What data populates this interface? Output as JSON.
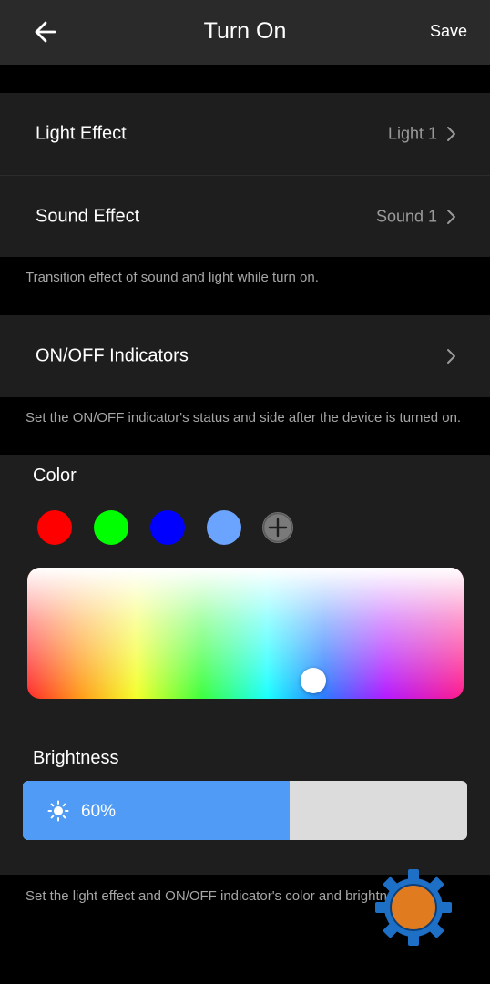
{
  "header": {
    "title": "Turn On",
    "save_label": "Save"
  },
  "effects": {
    "light": {
      "label": "Light Effect",
      "value": "Light 1"
    },
    "sound": {
      "label": "Sound Effect",
      "value": "Sound 1"
    },
    "hint": "Transition effect of sound and light while turn on."
  },
  "indicators": {
    "label": "ON/OFF Indicators",
    "hint": "Set the ON/OFF indicator's status and side after the device is turned on."
  },
  "color": {
    "title": "Color",
    "swatches": [
      "#ff0000",
      "#00ff00",
      "#0000ff",
      "#6aa4ff"
    ]
  },
  "brightness": {
    "title": "Brightness",
    "value_label": "60%",
    "level_percent": 60
  },
  "footer_hint": "Set the light effect and ON/OFF indicator's color and brightness.",
  "colors": {
    "header_bg": "#2a2a2a",
    "row_bg": "#1e1e1e",
    "accent": "#4f9bf6",
    "fab_ring": "#1e6fc6",
    "fab_center": "#e07b1f"
  },
  "icons": {
    "back": "arrow-left-icon",
    "chevron": "chevron-right-icon",
    "add": "plus-icon",
    "sun": "sun-icon",
    "fab": "gear-icon"
  }
}
